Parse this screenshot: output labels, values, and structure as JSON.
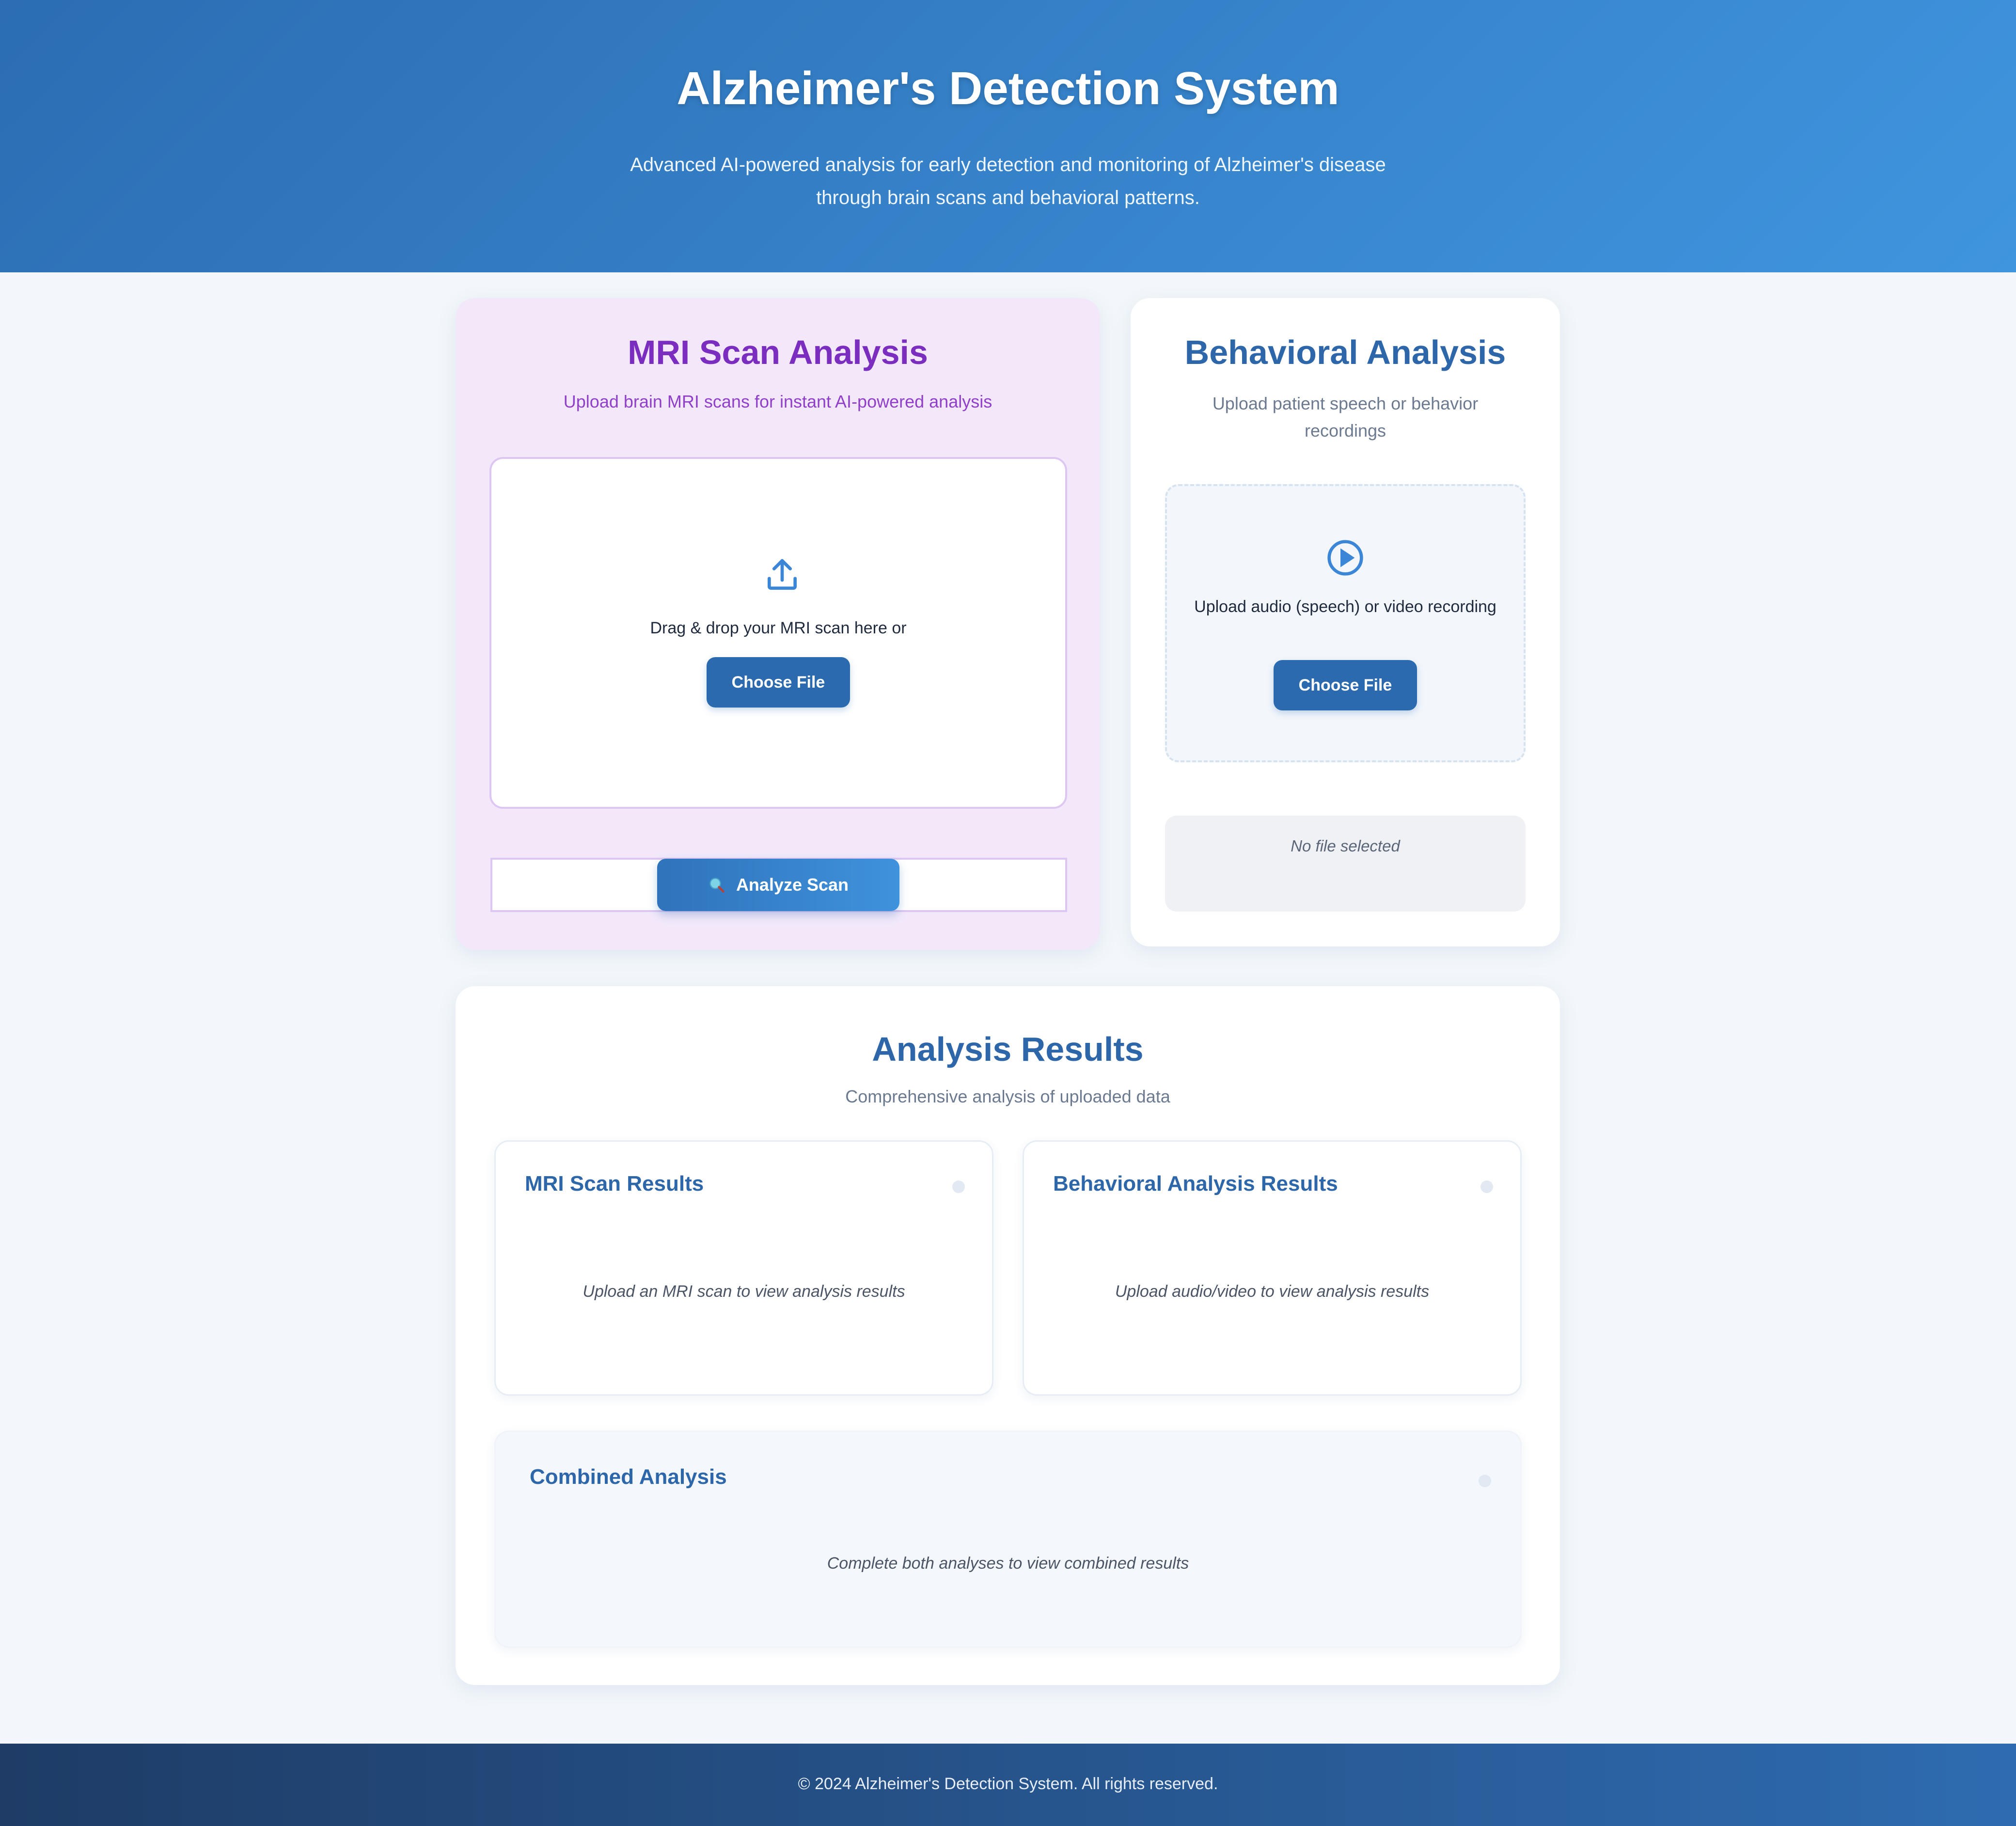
{
  "header": {
    "title": "Alzheimer's Detection System",
    "subtitle": "Advanced AI-powered analysis for early detection and monitoring of Alzheimer's disease through brain scans and behavioral patterns."
  },
  "mri": {
    "title": "MRI Scan Analysis",
    "subtitle": "Upload brain MRI scans for instant AI-powered analysis",
    "drop_text": "Drag & drop your MRI scan here or",
    "choose_label": "Choose File",
    "analyze_label": "Analyze Scan",
    "upload_icon": "upload-icon",
    "analyze_icon": "magnifier-icon"
  },
  "behavioral": {
    "title": "Behavioral Analysis",
    "subtitle": "Upload patient speech or behavior recordings",
    "drop_text": "Upload audio (speech) or video recording",
    "choose_label": "Choose File",
    "file_status": "No file selected",
    "icon": "play-circle-icon"
  },
  "results": {
    "title": "Analysis Results",
    "subtitle": "Comprehensive analysis of uploaded data",
    "mri": {
      "title": "MRI Scan Results",
      "placeholder": "Upload an MRI scan to view analysis results"
    },
    "behavioral": {
      "title": "Behavioral Analysis Results",
      "placeholder": "Upload audio/video to view analysis results"
    },
    "combined": {
      "title": "Combined Analysis",
      "placeholder": "Complete both analyses to view combined results"
    }
  },
  "footer": {
    "text": "© 2024 Alzheimer's Detection System. All rights reserved."
  },
  "colors": {
    "header_gradient_start": "#2c6db3",
    "header_gradient_end": "#3f95de",
    "mri_accent": "#7b2dbf",
    "primary_blue": "#2c6ab0",
    "page_background": "#f3f7fb"
  }
}
